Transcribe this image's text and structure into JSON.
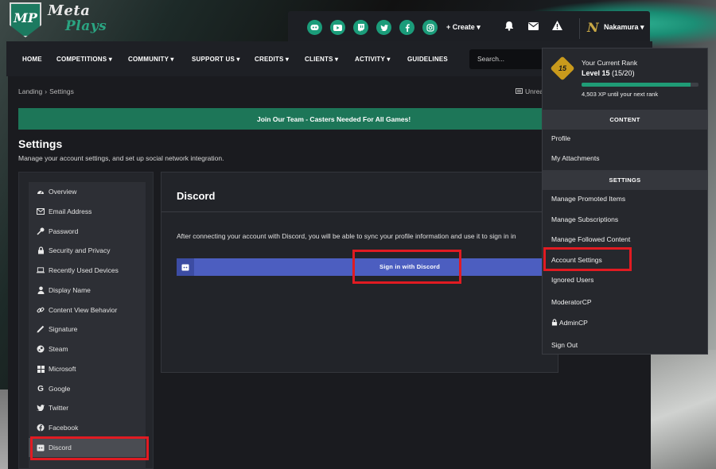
{
  "logo": {
    "monogram": "MP",
    "line1": "Meta",
    "line2": "Plays"
  },
  "topbar": {
    "social": [
      "discord-icon",
      "youtube-icon",
      "twitch-icon",
      "twitter-icon",
      "facebook-icon",
      "instagram-icon"
    ],
    "create_label": "+ Create ▾",
    "user_logo": "N",
    "username": "Nakamura ▾"
  },
  "nav": {
    "items": [
      "HOME",
      "COMPETITIONS ▾",
      "COMMUNITY ▾",
      "SUPPORT US ▾",
      "CREDITS ▾",
      "CLIENTS ▾",
      "ACTIVITY ▾",
      "GUIDELINES"
    ],
    "search_placeholder": "Search..."
  },
  "breadcrumb": {
    "home": "Landing",
    "sep": "›",
    "current": "Settings"
  },
  "unread_label": "Unrea",
  "banner": "Join Our Team - Casters Needed For All Games!",
  "page": {
    "title": "Settings",
    "description": "Manage your account settings, and set up social network integration."
  },
  "sidebar": {
    "items": [
      {
        "label": "Overview",
        "icon": "dashboard-icon"
      },
      {
        "label": "Email Address",
        "icon": "envelope-icon"
      },
      {
        "label": "Password",
        "icon": "key-icon"
      },
      {
        "label": "Security and Privacy",
        "icon": "lock-icon"
      },
      {
        "label": "Recently Used Devices",
        "icon": "laptop-icon"
      },
      {
        "label": "Display Name",
        "icon": "user-icon"
      },
      {
        "label": "Content View Behavior",
        "icon": "link-icon"
      },
      {
        "label": "Signature",
        "icon": "pen-icon"
      },
      {
        "label": "Steam",
        "icon": "steam-icon"
      },
      {
        "label": "Microsoft",
        "icon": "windows-icon"
      },
      {
        "label": "Google",
        "icon": "google-icon"
      },
      {
        "label": "Twitter",
        "icon": "twitter-icon"
      },
      {
        "label": "Facebook",
        "icon": "facebook-icon"
      },
      {
        "label": "Discord",
        "icon": "discord-icon",
        "active": true
      }
    ]
  },
  "content": {
    "title": "Discord",
    "text": "After connecting your account with Discord, you will be able to sync your profile information and use it to sign in in",
    "button_label": "Sign in with Discord"
  },
  "dropdown": {
    "rank_badge": "15",
    "rank_label": "Your Current Rank",
    "level_label": "Level 15",
    "level_progress": "(15/20)",
    "xp_fraction": 0.93,
    "xp_text": "4,503 XP until your next rank",
    "content_section": "CONTENT",
    "content_items": [
      "Profile",
      "My Attachments"
    ],
    "settings_section": "SETTINGS",
    "settings_items": [
      "Manage Promoted Items",
      "Manage Subscriptions",
      "Manage Followed Content",
      "Account Settings",
      "Ignored Users"
    ],
    "moderator": "ModeratorCP",
    "admin": "AdminCP",
    "signout": "Sign Out"
  },
  "colors": {
    "accent": "#1d7658",
    "discord": "#4c5ec0",
    "highlight": "#e11b22"
  }
}
